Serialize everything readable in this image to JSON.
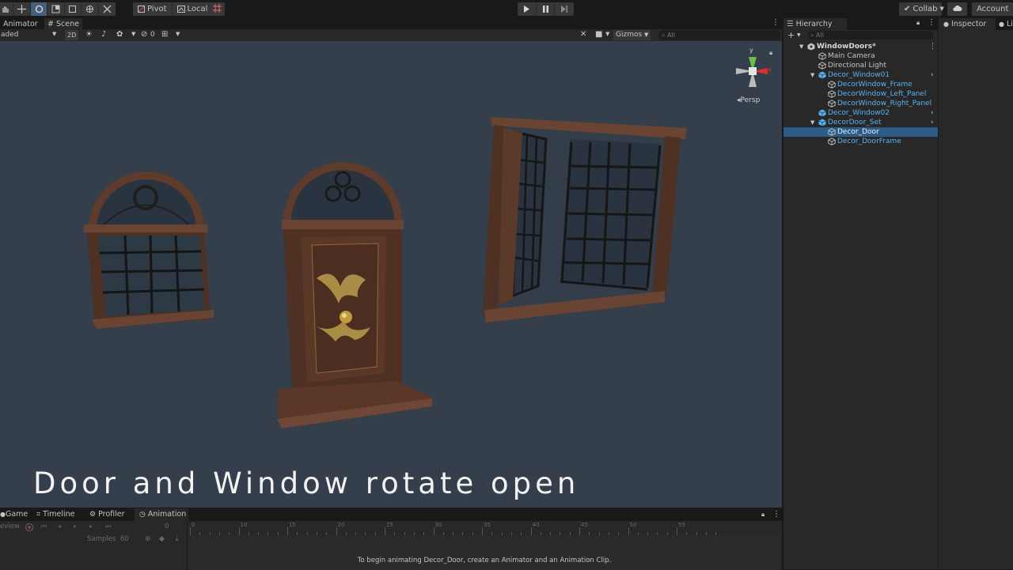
{
  "toolbar": {
    "pivot_label": "Pivot",
    "local_label": "Local",
    "collab_label": "Collab",
    "account_label": "Account"
  },
  "tabs": {
    "animator": "Animator",
    "scene": "Scene",
    "hierarchy": "Hierarchy",
    "inspector": "Inspector",
    "lighting": "Li"
  },
  "scene_toolbar": {
    "shading_mode": "aded",
    "mode_2d": "2D",
    "hidden_count": "0",
    "gizmos_label": "Gizmos",
    "search_placeholder": "All"
  },
  "scene": {
    "persp_label": "Persp",
    "gizmo_axes": {
      "y": "y",
      "x": "x"
    },
    "caption": "Door and Window rotate open"
  },
  "hierarchy": {
    "search_placeholder": "All",
    "items": [
      {
        "label": "WindowDoors*",
        "depth": 0,
        "icon": "unity-scene-icon",
        "kind": "scene"
      },
      {
        "label": "Main Camera",
        "depth": 1,
        "icon": "gameobject-icon",
        "kind": "plain"
      },
      {
        "label": "Directional Light",
        "depth": 1,
        "icon": "gameobject-icon",
        "kind": "plain"
      },
      {
        "label": "Decor_Window01",
        "depth": 1,
        "icon": "prefab-icon",
        "kind": "prefab",
        "expanded": true,
        "arrow": true
      },
      {
        "label": "DecorWindow_Frame",
        "depth": 2,
        "icon": "gameobject-icon",
        "kind": "prefab-child"
      },
      {
        "label": "DecorWindow_Left_Panel",
        "depth": 2,
        "icon": "gameobject-icon",
        "kind": "prefab-child"
      },
      {
        "label": "DecorWindow_Right_Panel",
        "depth": 2,
        "icon": "gameobject-icon",
        "kind": "prefab-child"
      },
      {
        "label": "Decor_Window02",
        "depth": 1,
        "icon": "prefab-icon",
        "kind": "prefab",
        "arrow": true
      },
      {
        "label": "DecorDoor_Set",
        "depth": 1,
        "icon": "prefab-icon",
        "kind": "prefab",
        "expanded": true,
        "arrow": true
      },
      {
        "label": "Decor_Door",
        "depth": 2,
        "icon": "gameobject-icon",
        "kind": "selected"
      },
      {
        "label": "Decor_DoorFrame",
        "depth": 2,
        "icon": "gameobject-icon",
        "kind": "prefab-child"
      }
    ]
  },
  "bottom_tabs": {
    "game": "Game",
    "timeline": "Timeline",
    "profiler": "Profiler",
    "animation": "Animation"
  },
  "animation": {
    "preview_label": "eview",
    "frame_value": "0",
    "samples_label": "Samples",
    "samples_value": "60",
    "message": "To begin animating Decor_Door, create an Animator and an Animation Clip.",
    "ruler_ticks": [
      "0",
      "10",
      "15",
      "20",
      "25",
      "30",
      "35",
      "40",
      "45",
      "50",
      "55"
    ]
  },
  "colors": {
    "selection": "#2c5d87",
    "prefab_blue": "#5cb1ef",
    "scene_bg": "#353e4b"
  }
}
